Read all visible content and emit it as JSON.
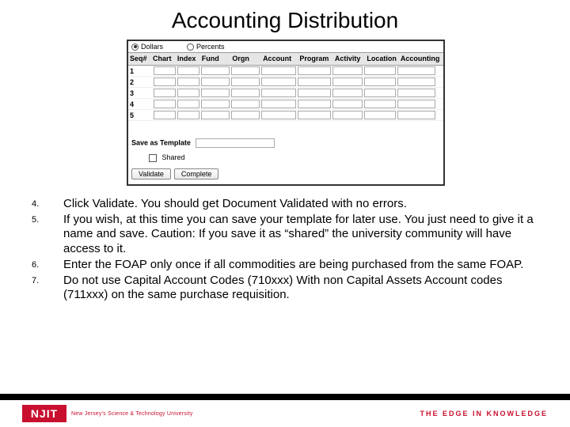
{
  "title": "Accounting Distribution",
  "form": {
    "radio_dollars": "Dollars",
    "radio_percents": "Percents",
    "headers": {
      "seq": "Seq#",
      "chart": "Chart",
      "index": "Index",
      "fund": "Fund",
      "orgn": "Orgn",
      "account": "Account",
      "program": "Program",
      "activity": "Activity",
      "location": "Location",
      "accounting": "Accounting"
    },
    "rows": [
      "1",
      "2",
      "3",
      "4",
      "5"
    ],
    "save_as_template": "Save as Template",
    "shared": "Shared",
    "validate_btn": "Validate",
    "complete_btn": "Complete"
  },
  "instructions": [
    {
      "num": "4.",
      "text": "Click Validate.  You should get Document Validated with no errors."
    },
    {
      "num": "5.",
      "text": "If you wish, at this time you can save your template for later use. You just need to give it a name and save. Caution: If you save it as “shared” the university community will have access to it."
    },
    {
      "num": "6.",
      "text": "Enter the FOAP only once if all commodities are being purchased from the same FOAP."
    },
    {
      "num": "7.",
      "text": "Do not use Capital Account Codes (710xxx) With non Capital Assets Account codes (711xxx) on the same purchase requisition."
    }
  ],
  "footer": {
    "logo_text": "NJIT",
    "logo_sub": "New Jersey's Science & Technology University",
    "tagline": "THE EDGE IN KNOWLEDGE"
  }
}
